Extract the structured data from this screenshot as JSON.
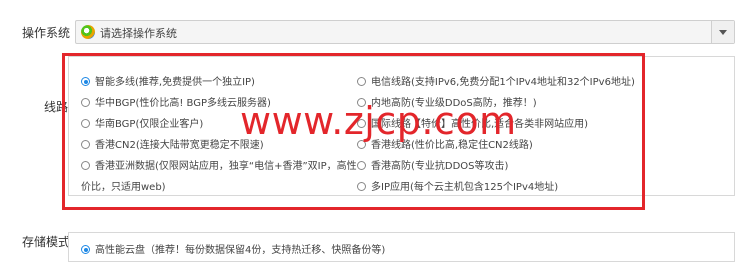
{
  "os": {
    "label": "操作系统",
    "placeholder": "请选择操作系统",
    "icon": "windows-logo-icon",
    "arrow_icon": "chevron-down-icon"
  },
  "line": {
    "label": "线路",
    "options": [
      {
        "label": "智能多线(推荐,免费提供一个独立IP)",
        "selected": true
      },
      {
        "label": "电信线路(支持IPv6,免费分配1个IPv4地址和32个IPv6地址)",
        "selected": false
      },
      {
        "label": "华中BGP(性价比高! BGP多线云服务器)",
        "selected": false
      },
      {
        "label": "内地高防(专业级DDoS高防，推荐！)",
        "selected": false
      },
      {
        "label": "华南BGP(仅限企业客户)",
        "selected": false
      },
      {
        "label": "国际线路【特价】高性价比,适合各类非网站应用)",
        "selected": false
      },
      {
        "label": "香港CN2(连接大陆带宽更稳定不限速)",
        "selected": false
      },
      {
        "label": "香港线路(性价比高,稳定住CN2线路)",
        "selected": false
      },
      {
        "label": "香港亚洲数据(仅限网站应用，独享“电信+香港”双IP，高性",
        "continuation": "价比，只适用web)",
        "selected": false
      },
      {
        "label": "香港高防(专业抗DDOS等攻击)",
        "selected": false
      },
      {
        "label": "多IP应用(每个云主机包含125个IPv4地址)",
        "selected": false
      }
    ]
  },
  "watermark": "www.zjcp.com",
  "accent_red": "#e3262b",
  "accent_blue": "#1e88e5",
  "storage": {
    "label": "存储模式",
    "options": [
      {
        "label": "高性能云盘（推荐！每份数据保留4份，支持热迁移、快照备份等)",
        "selected": true
      }
    ]
  }
}
